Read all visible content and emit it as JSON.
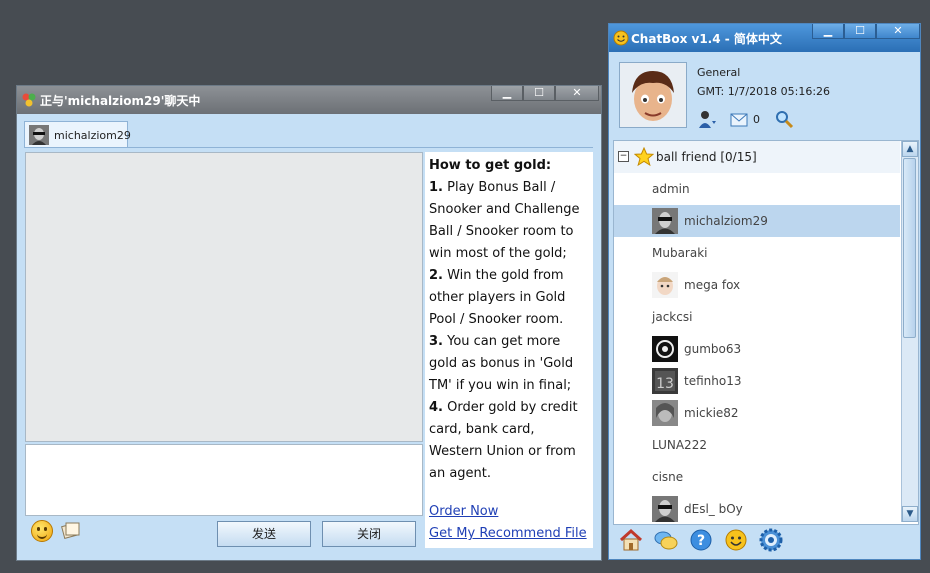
{
  "chat_window": {
    "title": "正与'michalziom29'聊天中",
    "tab_label": "michalziom29",
    "info": {
      "heading": "How to get gold:",
      "items": [
        {
          "num": "1.",
          "text": " Play Bonus Ball / Snooker and Challenge Ball / Snooker room to win most of the gold;"
        },
        {
          "num": "2.",
          "text": " Win the gold from other players in Gold Pool / Snooker room."
        },
        {
          "num": "3.",
          "text": " You can get more gold as bonus in 'Gold TM' if you win in final;"
        },
        {
          "num": "4.",
          "text": " Order gold by credit card, bank card, Western Union or from an agent."
        }
      ],
      "link_order": "Order Now",
      "link_file": "Get My Recommend File"
    },
    "send_label": "发送",
    "close_label": "关闭"
  },
  "chatbox": {
    "title": "ChatBox v1.4 - 简体中文",
    "profile_status": "General",
    "gmt": "GMT: 1/7/2018 05:16:26",
    "mail_count": "0",
    "group_label": "ball friend [0/15]",
    "friends": [
      {
        "name": "admin",
        "avatar": false
      },
      {
        "name": "michalziom29",
        "avatar": true,
        "selected": true
      },
      {
        "name": "Mubaraki",
        "avatar": false
      },
      {
        "name": "mega fox",
        "avatar": true
      },
      {
        "name": "jackcsi",
        "avatar": false
      },
      {
        "name": "gumbo63",
        "avatar": true
      },
      {
        "name": "tefinho13",
        "avatar": true
      },
      {
        "name": "mickie82",
        "avatar": true
      },
      {
        "name": "LUNA222",
        "avatar": false
      },
      {
        "name": "cisne",
        "avatar": false
      },
      {
        "name": "dEsl_ bOy",
        "avatar": true
      }
    ]
  },
  "window_buttons": {
    "minimize": "▁",
    "maximize": "☐",
    "close": "✕"
  },
  "icons": [
    "chat-app-icon",
    "smiley-icon",
    "paper-icon",
    "user-status-icon",
    "mail-icon",
    "search-icon",
    "home-icon",
    "chat-bubbles-icon",
    "help-icon",
    "emoticon-icon",
    "settings-icon",
    "star-icon"
  ]
}
